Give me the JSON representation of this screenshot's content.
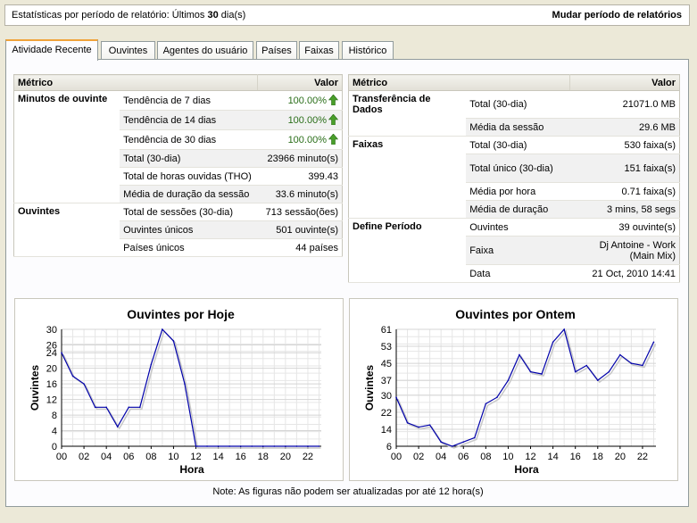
{
  "top": {
    "stats_prefix": "Estatísticas por período de relatório: Últimos ",
    "stats_days": "30",
    "stats_suffix": " dia(s)",
    "change_period": "Mudar período de relatórios"
  },
  "tabs": [
    {
      "label": "Atividade Recente",
      "active": true
    },
    {
      "label": "Ouvintes",
      "active": false
    },
    {
      "label": "Agentes do usuário",
      "active": false
    },
    {
      "label": "Países",
      "active": false
    },
    {
      "label": "Faixas",
      "active": false
    },
    {
      "label": "Histórico",
      "active": false
    }
  ],
  "left_table": {
    "col_metric": "Métrico",
    "col_value": "Valor",
    "rows": [
      {
        "group": "Minutos de ouvinte",
        "metric": "Tendência de 7 dias",
        "value": "100.00%",
        "trend": "up"
      },
      {
        "group": "",
        "metric": "Tendência de 14 dias",
        "value": "100.00%",
        "trend": "up"
      },
      {
        "group": "",
        "metric": "Tendência de 30 dias",
        "value": "100.00%",
        "trend": "up"
      },
      {
        "group": "",
        "metric": "Total (30-dia)",
        "value": "23966 minuto(s)"
      },
      {
        "group": "",
        "metric": "Total de horas ouvidas (THO)",
        "value": "399.43"
      },
      {
        "group": "",
        "metric": "Média de duração da sessão",
        "value": "33.6 minuto(s)"
      },
      {
        "group": "Ouvintes",
        "metric": "Total de sessões (30-dia)",
        "value": "713 sessão(ões)"
      },
      {
        "group": "",
        "metric": "Ouvintes únicos",
        "value": "501 ouvinte(s)"
      },
      {
        "group": "",
        "metric": "Países únicos",
        "value": "44 países"
      }
    ]
  },
  "right_table": {
    "col_metric": "Métrico",
    "col_value": "Valor",
    "rows": [
      {
        "group": "Transferência de Dados",
        "metric": "Total (30-dia)",
        "value": "21071.0 MB"
      },
      {
        "group": "",
        "metric": "Média da sessão",
        "value": "29.6 MB"
      },
      {
        "group": "Faixas",
        "metric": "Total (30-dia)",
        "value": "530 faixa(s)"
      },
      {
        "group": "",
        "metric": "Total único (30-dia)",
        "value": "151 faixa(s)"
      },
      {
        "group": "",
        "metric": "Média por hora",
        "value": "0.71 faixa(s)"
      },
      {
        "group": "",
        "metric": "Média de duração",
        "value": "3 mins, 58 segs"
      },
      {
        "group": "Define Período",
        "metric": "Ouvintes",
        "value": "39 ouvinte(s)"
      },
      {
        "group": "",
        "metric": "Faixa",
        "value": "Dj Antoine - Work (Main Mix)"
      },
      {
        "group": "",
        "metric": "Data",
        "value": "21 Oct, 2010 14:41"
      }
    ]
  },
  "chart_data": [
    {
      "type": "line",
      "title": "Ouvintes por Hoje",
      "xlabel": "Hora",
      "ylabel": "Ouvintes",
      "x": [
        0,
        1,
        2,
        3,
        4,
        5,
        6,
        7,
        8,
        9,
        10,
        11,
        12,
        13,
        14,
        15,
        16,
        17,
        18,
        19,
        20,
        21,
        22,
        23
      ],
      "x_ticks": [
        "00",
        "02",
        "04",
        "06",
        "08",
        "10",
        "12",
        "14",
        "16",
        "18",
        "20",
        "22"
      ],
      "y_ticks": [
        0,
        4,
        8,
        12,
        16,
        20,
        24,
        26,
        30
      ],
      "ylim": [
        0,
        30
      ],
      "values": [
        24,
        18,
        16,
        10,
        10,
        5,
        10,
        10,
        21,
        30,
        27,
        16,
        0,
        0,
        0,
        0,
        0,
        0,
        0,
        0,
        0,
        0,
        0,
        0
      ],
      "line_color": "#0000aa",
      "grid": true
    },
    {
      "type": "line",
      "title": "Ouvintes por Ontem",
      "xlabel": "Hora",
      "ylabel": "Ouvintes",
      "x": [
        0,
        1,
        2,
        3,
        4,
        5,
        6,
        7,
        8,
        9,
        10,
        11,
        12,
        13,
        14,
        15,
        16,
        17,
        18,
        19,
        20,
        21,
        22,
        23
      ],
      "x_ticks": [
        "00",
        "02",
        "04",
        "06",
        "08",
        "10",
        "12",
        "14",
        "16",
        "18",
        "20",
        "22"
      ],
      "y_ticks": [
        6,
        14,
        22,
        30,
        37,
        45,
        53,
        61
      ],
      "ylim": [
        6,
        61
      ],
      "values": [
        29,
        17,
        15,
        16,
        8,
        6,
        8,
        10,
        26,
        29,
        37,
        49,
        41,
        40,
        55,
        61,
        41,
        44,
        37,
        41,
        49,
        45,
        44,
        55
      ],
      "line_color": "#0000aa",
      "grid": true
    }
  ],
  "note": "Note: As figuras não podem ser atualizadas por até 12 hora(s)",
  "colors": {
    "accent_tab": "#f0a33a",
    "trend_green": "#2a6e19",
    "line_blue": "#0000aa"
  }
}
